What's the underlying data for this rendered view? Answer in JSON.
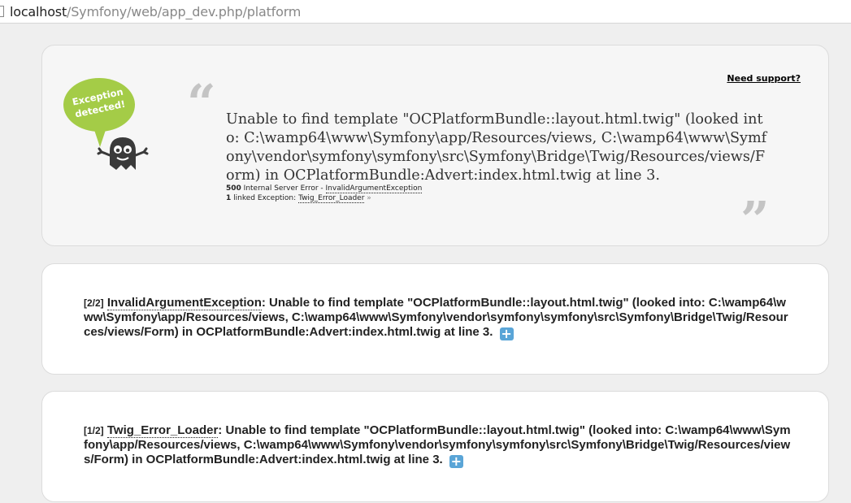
{
  "address_bar": {
    "host": "localhost",
    "path": "/Symfony/web/app_dev.php/platform"
  },
  "summary": {
    "need_support": "Need support?",
    "logo_text_line1": "Exception",
    "logo_text_line2": "detected!",
    "message": "Unable to find template \"OCPlatformBundle::layout.html.twig\" (looked into: C:\\wamp64\\www\\Symfony\\app/Resources/views, C:\\wamp64\\www\\Symfony\\vendor\\symfony\\symfony\\src\\Symfony\\Bridge\\Twig/Resources/views/Form) in OCPlatformBundle:Advert:index.html.twig at line 3.",
    "status_code": "500",
    "status_text": "Internal Server Error -",
    "exception_class": "InvalidArgumentException",
    "linked_count": "1",
    "linked_text": "linked Exception:",
    "linked_class": "Twig_Error_Loader",
    "linked_arrow": "»"
  },
  "exceptions": [
    {
      "counter": "[2/2]",
      "class": "InvalidArgumentException",
      "message": ": Unable to find template \"OCPlatformBundle::layout.html.twig\" (looked into: C:\\wamp64\\www\\Symfony\\app/Resources/views, C:\\wamp64\\www\\Symfony\\vendor\\symfony\\symfony\\src\\Symfony\\Bridge\\Twig/Resources/views/Form) in OCPlatformBundle:Advert:index.html.twig at line 3.",
      "toggle": "+"
    },
    {
      "counter": "[1/2]",
      "class": "Twig_Error_Loader",
      "message": ": Unable to find template \"OCPlatformBundle::layout.html.twig\" (looked into: C:\\wamp64\\www\\Symfony\\app/Resources/views, C:\\wamp64\\www\\Symfony\\vendor\\symfony\\symfony\\src\\Symfony\\Bridge\\Twig/Resources/views/Form) in OCPlatformBundle:Advert:index.html.twig at line 3.",
      "toggle": "+"
    }
  ],
  "colors": {
    "logo_green": "#a4cc47",
    "ghost": "#3a3a3a",
    "toggle_blue": "#5aa5d7"
  }
}
